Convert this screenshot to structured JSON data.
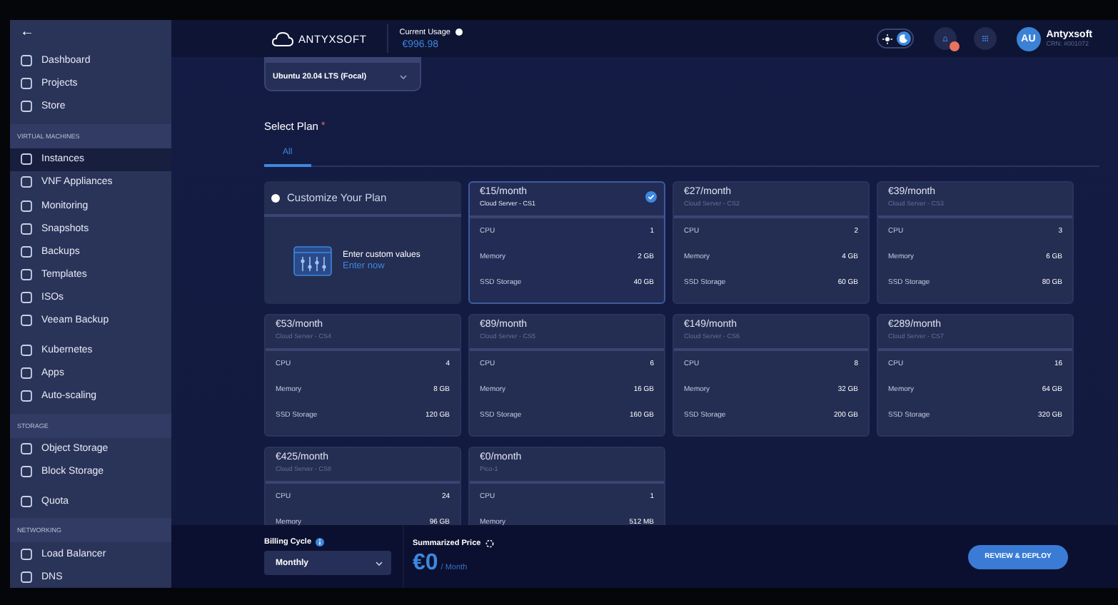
{
  "sidebar": {
    "back": "←",
    "sections": [
      {
        "items": [
          {
            "label": "Dashboard",
            "selected": false
          },
          {
            "label": "Projects",
            "selected": false
          },
          {
            "label": "Store",
            "selected": false
          }
        ]
      },
      {
        "heading": "VIRTUAL MACHINES",
        "items": [
          {
            "label": "Instances",
            "selected": true
          },
          {
            "label": "VNF Appliances",
            "selected": false
          },
          {
            "label": "Monitoring",
            "selected": false
          },
          {
            "label": "Snapshots",
            "selected": false
          },
          {
            "label": "Backups",
            "selected": false
          },
          {
            "label": "Templates",
            "selected": false
          },
          {
            "label": "ISOs",
            "selected": false
          },
          {
            "label": "Veeam Backup",
            "selected": false
          }
        ]
      },
      {
        "items": [
          {
            "label": "Kubernetes",
            "selected": false
          },
          {
            "label": "Apps",
            "selected": false
          },
          {
            "label": "Auto-scaling",
            "selected": false
          }
        ]
      },
      {
        "heading": "STORAGE",
        "items": [
          {
            "label": "Object Storage",
            "selected": false
          },
          {
            "label": "Block Storage",
            "selected": false
          }
        ]
      },
      {
        "items": [
          {
            "label": "Quota",
            "selected": false
          }
        ]
      },
      {
        "heading": "NETWORKING",
        "items": [
          {
            "label": "Load Balancer",
            "selected": false
          },
          {
            "label": "DNS",
            "selected": false
          }
        ]
      }
    ]
  },
  "header": {
    "dark_mode": true,
    "brand": "ANTYXSOFT",
    "usage_label": "Current Usage",
    "usage_value": "€996.98",
    "user": {
      "initials": "AU",
      "name": "Antyxsoft",
      "crn": "CRN: #001072"
    }
  },
  "image_select": {
    "value": "Ubuntu 20.04 LTS (Focal)"
  },
  "plan": {
    "title": "Select Plan",
    "required_mark": "*",
    "tabs": [
      {
        "label": "All",
        "selected": true
      }
    ],
    "custom": {
      "title": "Customize Your Plan",
      "selected": false,
      "prompt": "Enter custom values",
      "link": "Enter now"
    },
    "plans": [
      {
        "price": "€15/month",
        "name": "Cloud Server - CS1",
        "selected": true,
        "specs": [
          {
            "label": "CPU",
            "value": "1"
          },
          {
            "label": "Memory",
            "value": "2 GB"
          },
          {
            "label": "SSD Storage",
            "value": "40 GB"
          }
        ]
      },
      {
        "price": "€27/month",
        "name": "Cloud Server - CS2",
        "selected": false,
        "specs": [
          {
            "label": "CPU",
            "value": "2"
          },
          {
            "label": "Memory",
            "value": "4 GB"
          },
          {
            "label": "SSD Storage",
            "value": "60 GB"
          }
        ]
      },
      {
        "price": "€39/month",
        "name": "Cloud Server - CS3",
        "selected": false,
        "specs": [
          {
            "label": "CPU",
            "value": "3"
          },
          {
            "label": "Memory",
            "value": "6 GB"
          },
          {
            "label": "SSD Storage",
            "value": "80 GB"
          }
        ]
      },
      {
        "price": "€53/month",
        "name": "Cloud Server - CS4",
        "selected": false,
        "specs": [
          {
            "label": "CPU",
            "value": "4"
          },
          {
            "label": "Memory",
            "value": "8 GB"
          },
          {
            "label": "SSD Storage",
            "value": "120 GB"
          }
        ]
      },
      {
        "price": "€89/month",
        "name": "Cloud Server - CS5",
        "selected": false,
        "specs": [
          {
            "label": "CPU",
            "value": "6"
          },
          {
            "label": "Memory",
            "value": "16 GB"
          },
          {
            "label": "SSD Storage",
            "value": "160 GB"
          }
        ]
      },
      {
        "price": "€149/month",
        "name": "Cloud Server - CS6",
        "selected": false,
        "specs": [
          {
            "label": "CPU",
            "value": "8"
          },
          {
            "label": "Memory",
            "value": "32 GB"
          },
          {
            "label": "SSD Storage",
            "value": "200 GB"
          }
        ]
      },
      {
        "price": "€289/month",
        "name": "Cloud Server - CS7",
        "selected": false,
        "specs": [
          {
            "label": "CPU",
            "value": "16"
          },
          {
            "label": "Memory",
            "value": "64 GB"
          },
          {
            "label": "SSD Storage",
            "value": "320 GB"
          }
        ]
      },
      {
        "price": "€425/month",
        "name": "Cloud Server - CS8",
        "selected": false,
        "specs": [
          {
            "label": "CPU",
            "value": "24"
          },
          {
            "label": "Memory",
            "value": "96 GB"
          }
        ]
      },
      {
        "price": "€0/month",
        "name": "Pico-1",
        "selected": false,
        "specs": [
          {
            "label": "CPU",
            "value": "1"
          },
          {
            "label": "Memory",
            "value": "512 MB"
          }
        ]
      }
    ]
  },
  "footer": {
    "billing_label": "Billing Cycle",
    "billing_value": "Monthly",
    "price_label": "Summarized Price",
    "price": "€0",
    "period": "/ Month",
    "button": "REVIEW & DEPLOY"
  }
}
